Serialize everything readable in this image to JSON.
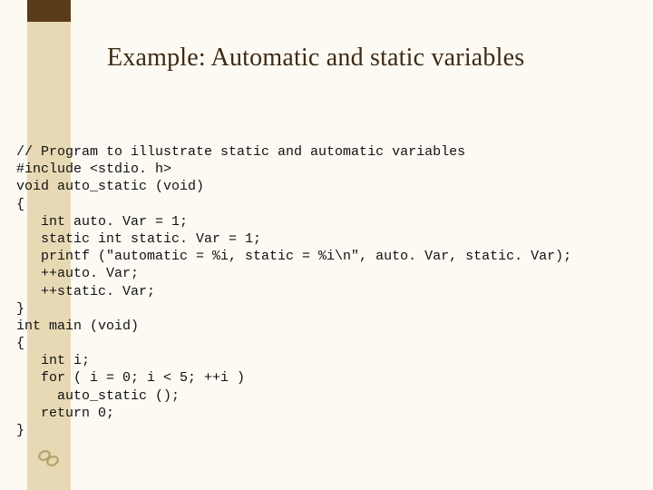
{
  "title": "Example: Automatic and static variables",
  "code": {
    "l01": "// Program to illustrate static and automatic variables",
    "l02": "#include <stdio. h>",
    "l03": "void auto_static (void)",
    "l04": "{",
    "l05": "   int auto. Var = 1;",
    "l06": "   static int static. Var = 1;",
    "l07": "   printf (\"automatic = %i, static = %i\\n\", auto. Var, static. Var);",
    "l08": "   ++auto. Var;",
    "l09": "   ++static. Var;",
    "l10": "}",
    "l11": "int main (void)",
    "l12": "{",
    "l13": "   int i;",
    "l14": "   for ( i = 0; i < 5; ++i )",
    "l15": "     auto_static ();",
    "l16": "   return 0;",
    "l17": "}"
  }
}
